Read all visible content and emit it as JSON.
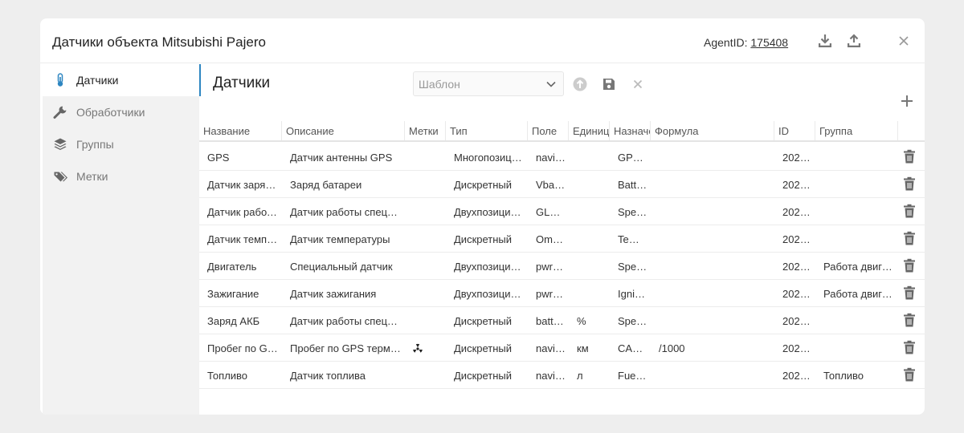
{
  "dialog": {
    "title": "Датчики объекта Mitsubishi Pajero",
    "agent_label": "AgentID: ",
    "agent_id": "175408"
  },
  "sidebar": {
    "items": [
      {
        "label": "Датчики",
        "icon": "thermometer-icon",
        "active": true
      },
      {
        "label": "Обработчики",
        "icon": "wrench-icon",
        "active": false
      },
      {
        "label": "Группы",
        "icon": "layers-icon",
        "active": false
      },
      {
        "label": "Метки",
        "icon": "tags-icon",
        "active": false
      }
    ]
  },
  "main": {
    "title": "Датчики",
    "template_placeholder": "Шаблон"
  },
  "table": {
    "columns": [
      "Название",
      "Описание",
      "Метки",
      "Тип",
      "Поле",
      "Единица",
      "Назначение",
      "Формула",
      "ID",
      "Группа"
    ],
    "rows": [
      [
        "GPS",
        "Датчик антенны GPS",
        "",
        "Многопозиционный",
        "navitel",
        "",
        "GPS антенна",
        "",
        "2023...",
        ""
      ],
      [
        "Датчик заряда батареи",
        "Заряд батареи",
        "",
        "Дискретный",
        "Vbattery",
        "",
        "Battery",
        "",
        "2023...",
        ""
      ],
      [
        "Датчик работы спецоборудования",
        "Датчик работы спецоборудования",
        "",
        "Двухпозиционный",
        "GLNSS",
        "",
        "Special",
        "",
        "2024...",
        ""
      ],
      [
        "Датчик температуры",
        "Датчик температуры",
        "",
        "Дискретный",
        "Omnicomm",
        "",
        "Temperature",
        "",
        "2023...",
        ""
      ],
      [
        "Двигатель",
        "Специальный датчик",
        "",
        "Двухпозиционный",
        "pwr_ext",
        "",
        "Special",
        "",
        "2023...",
        "Работа двигателя"
      ],
      [
        "Зажигание",
        "Датчик зажигания",
        "",
        "Двухпозиционный",
        "pwr_ext",
        "",
        "Ignition",
        "",
        "2023...",
        "Работа двигателя"
      ],
      [
        "Заряд АКБ",
        "Датчик работы спецоборудования",
        "",
        "Дискретный",
        "battery",
        "%",
        "Special",
        "",
        "2023...",
        ""
      ],
      [
        "Пробег по GPS терминалу",
        "Пробег по GPS терминал",
        "radiation-icon",
        "Дискретный",
        "navitel",
        "км",
        "CAN пробег",
        "/1000",
        "2023...",
        ""
      ],
      [
        "Топливо",
        "Датчик топлива",
        "",
        "Дискретный",
        "navitel",
        "л",
        "Fuel sensor",
        "",
        "2023...",
        "Топливо"
      ]
    ]
  },
  "colors": {
    "accent": "#2e86c1",
    "sidebar_bg": "#f2f2f2",
    "page_bg": "#eeeeee",
    "icon_gray": "#777777"
  }
}
